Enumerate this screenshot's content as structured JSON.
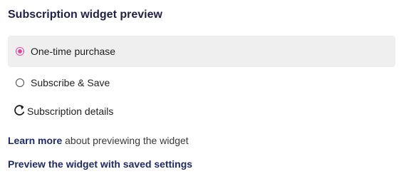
{
  "header": {
    "title": "Subscription widget preview"
  },
  "options": [
    {
      "label": "One-time purchase",
      "selected": true
    },
    {
      "label": "Subscribe & Save",
      "selected": false
    }
  ],
  "details": {
    "icon": "refresh-icon",
    "label": "Subscription details"
  },
  "learn_more": {
    "link_text": "Learn more",
    "suffix_text": " about previewing the widget"
  },
  "preview_link": {
    "label": "Preview the widget with saved settings"
  },
  "colors": {
    "accent": "#e8439b",
    "link": "#1f2a6b",
    "title": "#1f2147",
    "selected_background": "#efefef"
  }
}
